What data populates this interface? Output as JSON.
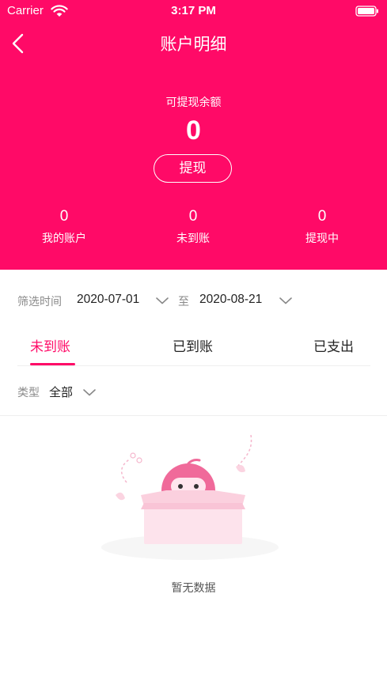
{
  "status_bar": {
    "carrier": "Carrier",
    "time": "3:17 PM"
  },
  "header": {
    "title": "账户明细",
    "balance_label": "可提现余额",
    "balance_value": "0",
    "withdraw_label": "提现",
    "stats": [
      {
        "value": "0",
        "label": "我的账户"
      },
      {
        "value": "0",
        "label": "未到账"
      },
      {
        "value": "0",
        "label": "提现中"
      }
    ]
  },
  "filter": {
    "label": "筛选时间",
    "start_date": "2020-07-01",
    "to_label": "至",
    "end_date": "2020-08-21"
  },
  "tabs": [
    {
      "label": "未到账",
      "active": true
    },
    {
      "label": "已到账",
      "active": false
    },
    {
      "label": "已支出",
      "active": false
    }
  ],
  "type_filter": {
    "label": "类型",
    "value": "全部"
  },
  "empty_state": {
    "text": "暂无数据"
  },
  "colors": {
    "brand": "#ff0a67",
    "muted": "#8a8a8a",
    "divider": "#eeeeee"
  }
}
